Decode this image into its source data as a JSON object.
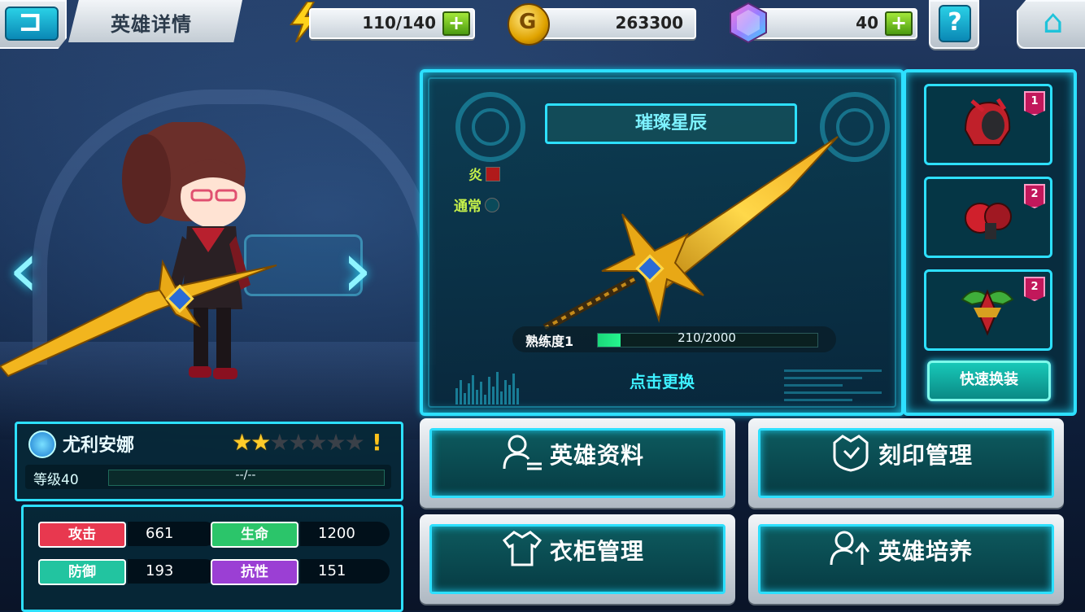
{
  "header": {
    "title": "英雄详情",
    "energy": "110/140",
    "gold": "263300",
    "gems": "40",
    "help_label": "?"
  },
  "weapon": {
    "name": "璀璨星辰",
    "element": "炎",
    "attack_type": "通常",
    "mastery_label": "熟练度1",
    "mastery_value": "210/2000",
    "mastery_fraction": 0.105,
    "change_label": "点击更换"
  },
  "equipment": {
    "slots": [
      {
        "name": "helmet-icon",
        "level": "1"
      },
      {
        "name": "gauntlet-icon",
        "level": "2"
      },
      {
        "name": "emblem-icon",
        "level": "2"
      }
    ],
    "quick_equip_label": "快速换装"
  },
  "hero": {
    "name": "尤利安娜",
    "stars_filled": 2,
    "stars_total": 7,
    "warning": "!",
    "level_label": "等级40",
    "level_progress": "--/--"
  },
  "stats": [
    {
      "label": "攻击",
      "value": "661",
      "color": "#e8384f"
    },
    {
      "label": "生命",
      "value": "1200",
      "color": "#2bc56a"
    },
    {
      "label": "防御",
      "value": "193",
      "color": "#22c4a0"
    },
    {
      "label": "抗性",
      "value": "151",
      "color": "#9b3fd4"
    }
  ],
  "menu": {
    "hero_profile": "英雄资料",
    "engrave_manage": "刻印管理",
    "wardrobe_manage": "衣柜管理",
    "hero_training": "英雄培养"
  },
  "colors": {
    "accent_cyan": "#2de0ff",
    "mastery_green": "#24f58e",
    "star_gold": "#ffcc2a"
  }
}
